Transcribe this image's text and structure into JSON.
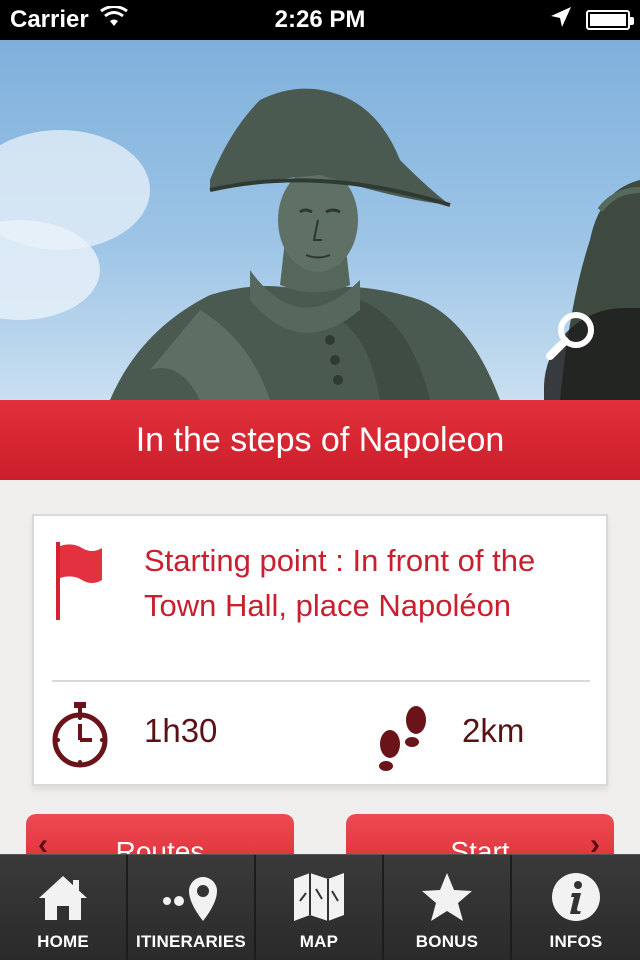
{
  "status_bar": {
    "carrier": "Carrier",
    "time": "2:26 PM",
    "icons": [
      "wifi-icon",
      "location-arrow-icon",
      "battery-icon"
    ]
  },
  "hero": {
    "image_subject": "statue-of-napoleon",
    "zoom_icon": "magnifier-icon"
  },
  "title": "In the steps of Napoleon",
  "info": {
    "starting_point": "Starting point : In front of the Town Hall, place Napoléon",
    "duration": "1h30",
    "distance": "2km",
    "icons": [
      "flag-icon",
      "stopwatch-icon",
      "footsteps-icon"
    ]
  },
  "actions": {
    "routes_label": "Routes",
    "start_label": "Start"
  },
  "tab_bar": {
    "items": [
      {
        "label": "HOME",
        "icon": "home-icon"
      },
      {
        "label": "ITINERARIES",
        "icon": "itinerary-pin-icon"
      },
      {
        "label": "MAP",
        "icon": "map-icon"
      },
      {
        "label": "BONUS",
        "icon": "star-icon"
      },
      {
        "label": "INFOS",
        "icon": "info-icon"
      }
    ]
  },
  "colors": {
    "accent": "#cc1e2b",
    "dark_red": "#5a1014",
    "tab_bar": "#2f2f2f"
  }
}
